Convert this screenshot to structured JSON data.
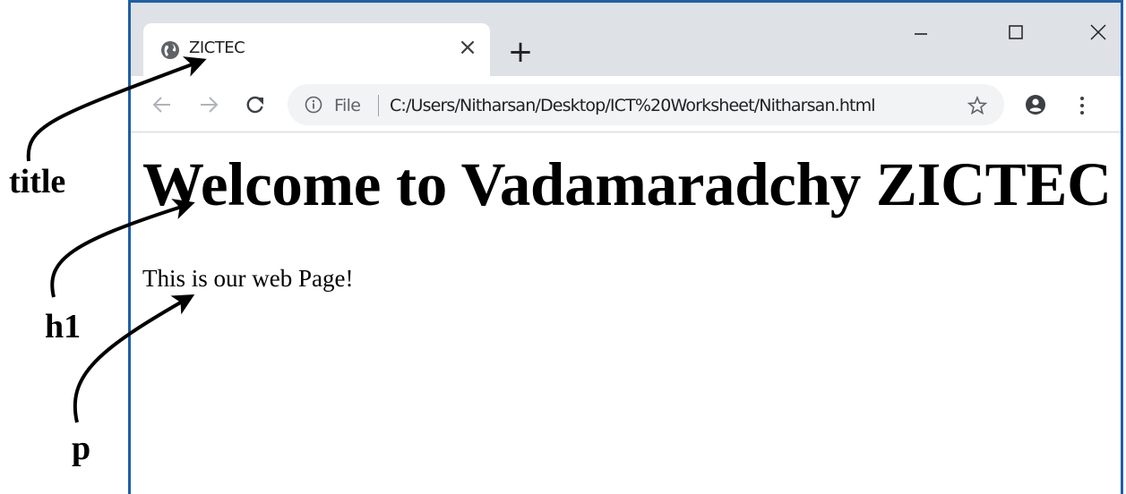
{
  "browser": {
    "tab": {
      "title": "ZICTEC",
      "favicon": "globe-icon",
      "close_glyph": "×"
    },
    "new_tab_glyph": "+",
    "window_controls": [
      "minimize-icon",
      "maximize-icon",
      "close-icon"
    ],
    "nav": [
      "back-arrow-icon",
      "forward-arrow-icon",
      "reload-icon"
    ],
    "address_bar": {
      "info_icon": "info-icon",
      "scheme": "File",
      "url": "C:/Users/Nitharsan/Desktop/ICT%20Worksheet/Nitharsan.html"
    },
    "toolbar_icons": [
      "star-icon",
      "account-icon",
      "menu-icon"
    ],
    "frame_color": "#1e5fa8"
  },
  "page": {
    "h1": "Welcome to Vadamaradchy ZICTEC",
    "p": "This is our web Page!"
  },
  "annotations": {
    "title_label": "title",
    "h1_label": "h1",
    "p_label": "p"
  }
}
